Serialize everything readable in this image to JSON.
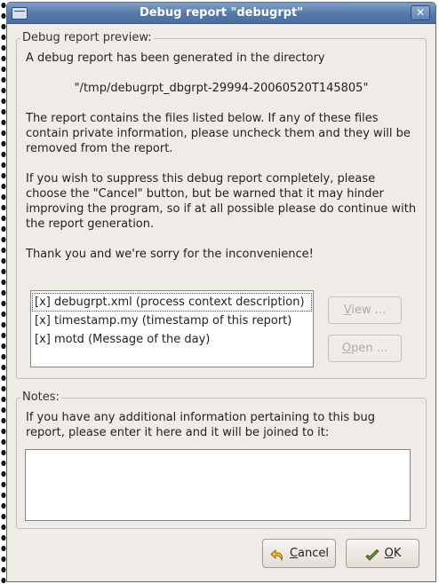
{
  "window": {
    "title": "Debug report \"debugrpt\"",
    "close_glyph": "✕"
  },
  "preview": {
    "legend": "Debug report preview:",
    "intro": "A debug report has been generated in the directory",
    "directory": "\"/tmp/debugrpt_dbgrpt-29994-20060520T145805\"",
    "files_note": "The report contains the files listed below. If any of these files contain private information, please uncheck them and they will be removed from the report.",
    "suppress_note": "If you wish to suppress this debug report completely, please choose the \"Cancel\" button, but be warned that it may hinder improving the program, so if at all possible please do continue with the report generation.",
    "thanks": "Thank you and we're sorry for the inconvenience!",
    "files": [
      "[x] debugrpt.xml (process context description)",
      "[x] timestamp.my (timestamp of this report)",
      "[x] motd (Message of the day)"
    ],
    "view_button": {
      "pre": "",
      "mnemonic": "V",
      "post": "iew ..."
    },
    "open_button": {
      "pre": "",
      "mnemonic": "O",
      "post": "pen ..."
    }
  },
  "notes": {
    "legend": "Notes:",
    "instructions": "If you have any additional information pertaining to this bug report, please enter it here and it will be joined to it:",
    "value": ""
  },
  "buttons": {
    "cancel": {
      "pre": "",
      "mnemonic": "C",
      "post": "ancel",
      "icon": "undo-arrow-icon"
    },
    "ok": {
      "pre": "",
      "mnemonic": "O",
      "post": "K",
      "icon": "checkmark-hand-icon"
    }
  },
  "colors": {
    "titlebar": "#5578ab",
    "dialog_bg": "#efebe7"
  }
}
